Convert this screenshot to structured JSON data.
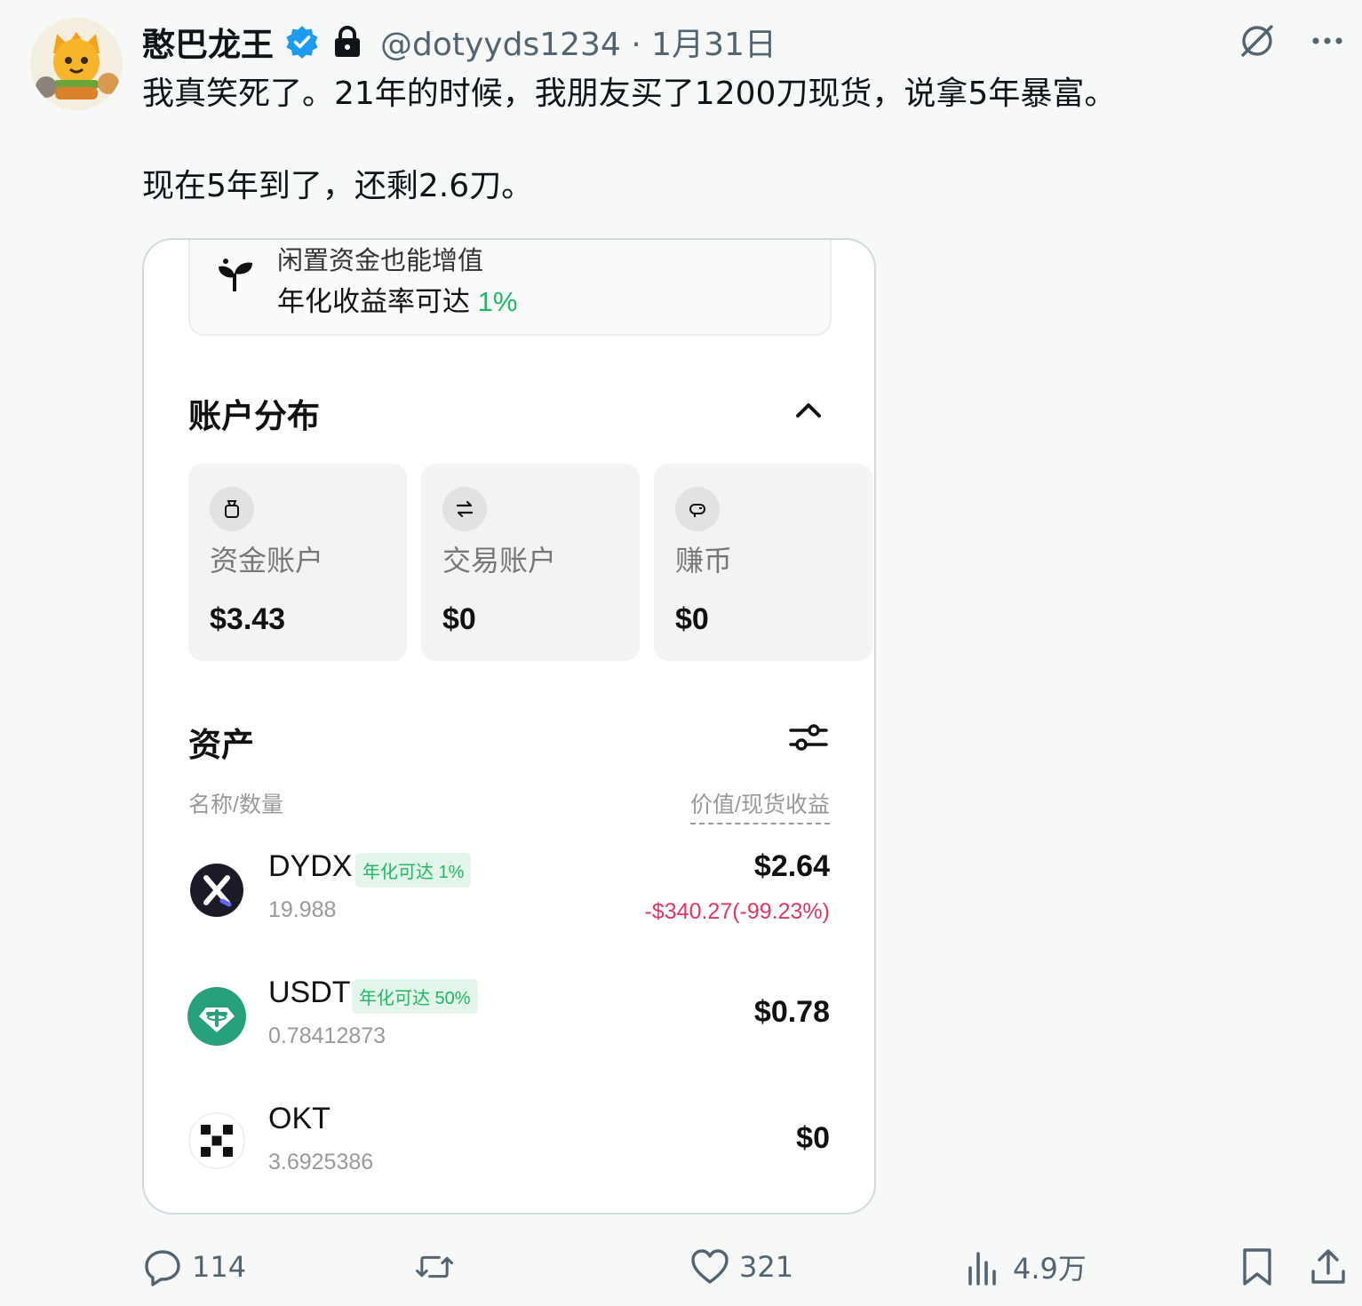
{
  "author": {
    "display_name": "憨巴龙王",
    "handle": "@dotyyds1234",
    "date": "1月31日",
    "verified": true,
    "protected": true
  },
  "tweet": {
    "line1": "我真笑死了。21年的时候，我朋友买了1200刀现货，说拿5年暴富。",
    "line2": "现在5年到了，还剩2.6刀。"
  },
  "media": {
    "earn_banner": {
      "line1": "闲置资金也能增值",
      "line2": "年化收益率可达",
      "rate": "1%"
    },
    "accounts_section": {
      "title": "账户分布",
      "cards": [
        {
          "label": "资金账户",
          "value": "$3.43",
          "icon": "money-bag-icon"
        },
        {
          "label": "交易账户",
          "value": "$0",
          "icon": "swap-arrows-icon"
        },
        {
          "label": "赚币",
          "value": "$0",
          "icon": "piggy-icon"
        }
      ]
    },
    "assets_section": {
      "title": "资产",
      "col_left": "名称/数量",
      "col_right": "价值/现货收益",
      "assets": [
        {
          "symbol": "DYDX",
          "badge": "年化可达 1%",
          "quantity": "19.988",
          "value": "$2.64",
          "pnl": "-$340.27(-99.23%)"
        },
        {
          "symbol": "USDT",
          "badge": "年化可达 50%",
          "quantity": "0.78412873",
          "value": "$0.78",
          "pnl": ""
        },
        {
          "symbol": "OKT",
          "badge": "",
          "quantity": "3.6925386",
          "value": "$0",
          "pnl": ""
        }
      ]
    },
    "colors": {
      "green": "#1eb965",
      "red": "#e0365f",
      "usdt": "#26a17b"
    }
  },
  "actions": {
    "replies": "114",
    "retweets": "",
    "likes": "321",
    "views": "4.9万"
  },
  "colors": {
    "verified_blue": "#1d9bf0",
    "secondary_text": "#536471"
  }
}
